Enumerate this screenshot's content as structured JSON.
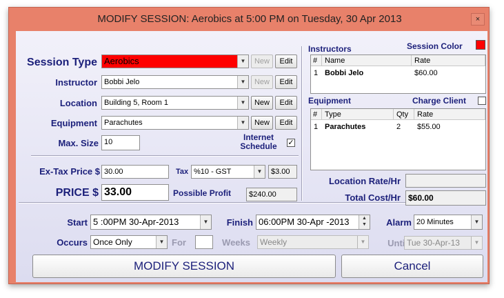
{
  "window": {
    "title": "MODIFY SESSION: Aerobics at 5:00 PM on Tuesday, 30 Apr 2013",
    "close": "×"
  },
  "left": {
    "session_type": {
      "label": "Session Type",
      "value": "Aerobics"
    },
    "instructor": {
      "label": "Instructor",
      "value": "Bobbi Jelo"
    },
    "location": {
      "label": "Location",
      "value": "Building 5, Room 1"
    },
    "equipment": {
      "label": "Equipment",
      "value": "Parachutes"
    },
    "max_size": {
      "label": "Max. Size",
      "value": "10"
    },
    "internet_schedule": {
      "label_line1": "Internet",
      "label_line2": "Schedule",
      "checked": true
    },
    "buttons": {
      "new": "New",
      "edit": "Edit"
    }
  },
  "pricing": {
    "ex_tax_label": "Ex-Tax Price $",
    "ex_tax_value": "30.00",
    "tax_label": "Tax",
    "tax_value": "%10 - GST",
    "tax_amount": "$3.00",
    "price_label": "PRICE $",
    "price_value": "33.00",
    "profit_label": "Possible Profit",
    "profit_value": "$240.00"
  },
  "right": {
    "instructors_header": "Instructors",
    "session_color_label": "Session Color",
    "session_color": "#ff0000",
    "instructors_table": {
      "columns": [
        "#",
        "Name",
        "Rate"
      ],
      "rows": [
        [
          "1",
          "Bobbi Jelo",
          "$60.00"
        ]
      ]
    },
    "equipment_header": "Equipment",
    "charge_client_label": "Charge Client",
    "charge_client_checked": false,
    "equipment_table": {
      "columns": [
        "#",
        "Type",
        "Qty",
        "Rate"
      ],
      "rows": [
        [
          "1",
          "Parachutes",
          "2",
          "$55.00"
        ]
      ]
    },
    "location_rate_label": "Location Rate/Hr",
    "location_rate_value": "",
    "total_cost_label": "Total Cost/Hr",
    "total_cost_value": "$60.00"
  },
  "schedule": {
    "start_label": "Start",
    "start_value": "5 :00PM 30-Apr-2013",
    "finish_label": "Finish",
    "finish_value": "06:00PM 30-Apr -2013",
    "alarm_label": "Alarm",
    "alarm_value": "20 Minutes",
    "occurs_label": "Occurs",
    "occurs_value": "Once Only",
    "for_label": "For",
    "for_value": "",
    "weeks_label": "Weeks",
    "weeks_value": "Weekly",
    "until_label": "Until",
    "until_value": "Tue 30-Apr-13"
  },
  "actions": {
    "modify": "MODIFY SESSION",
    "cancel": "Cancel"
  }
}
